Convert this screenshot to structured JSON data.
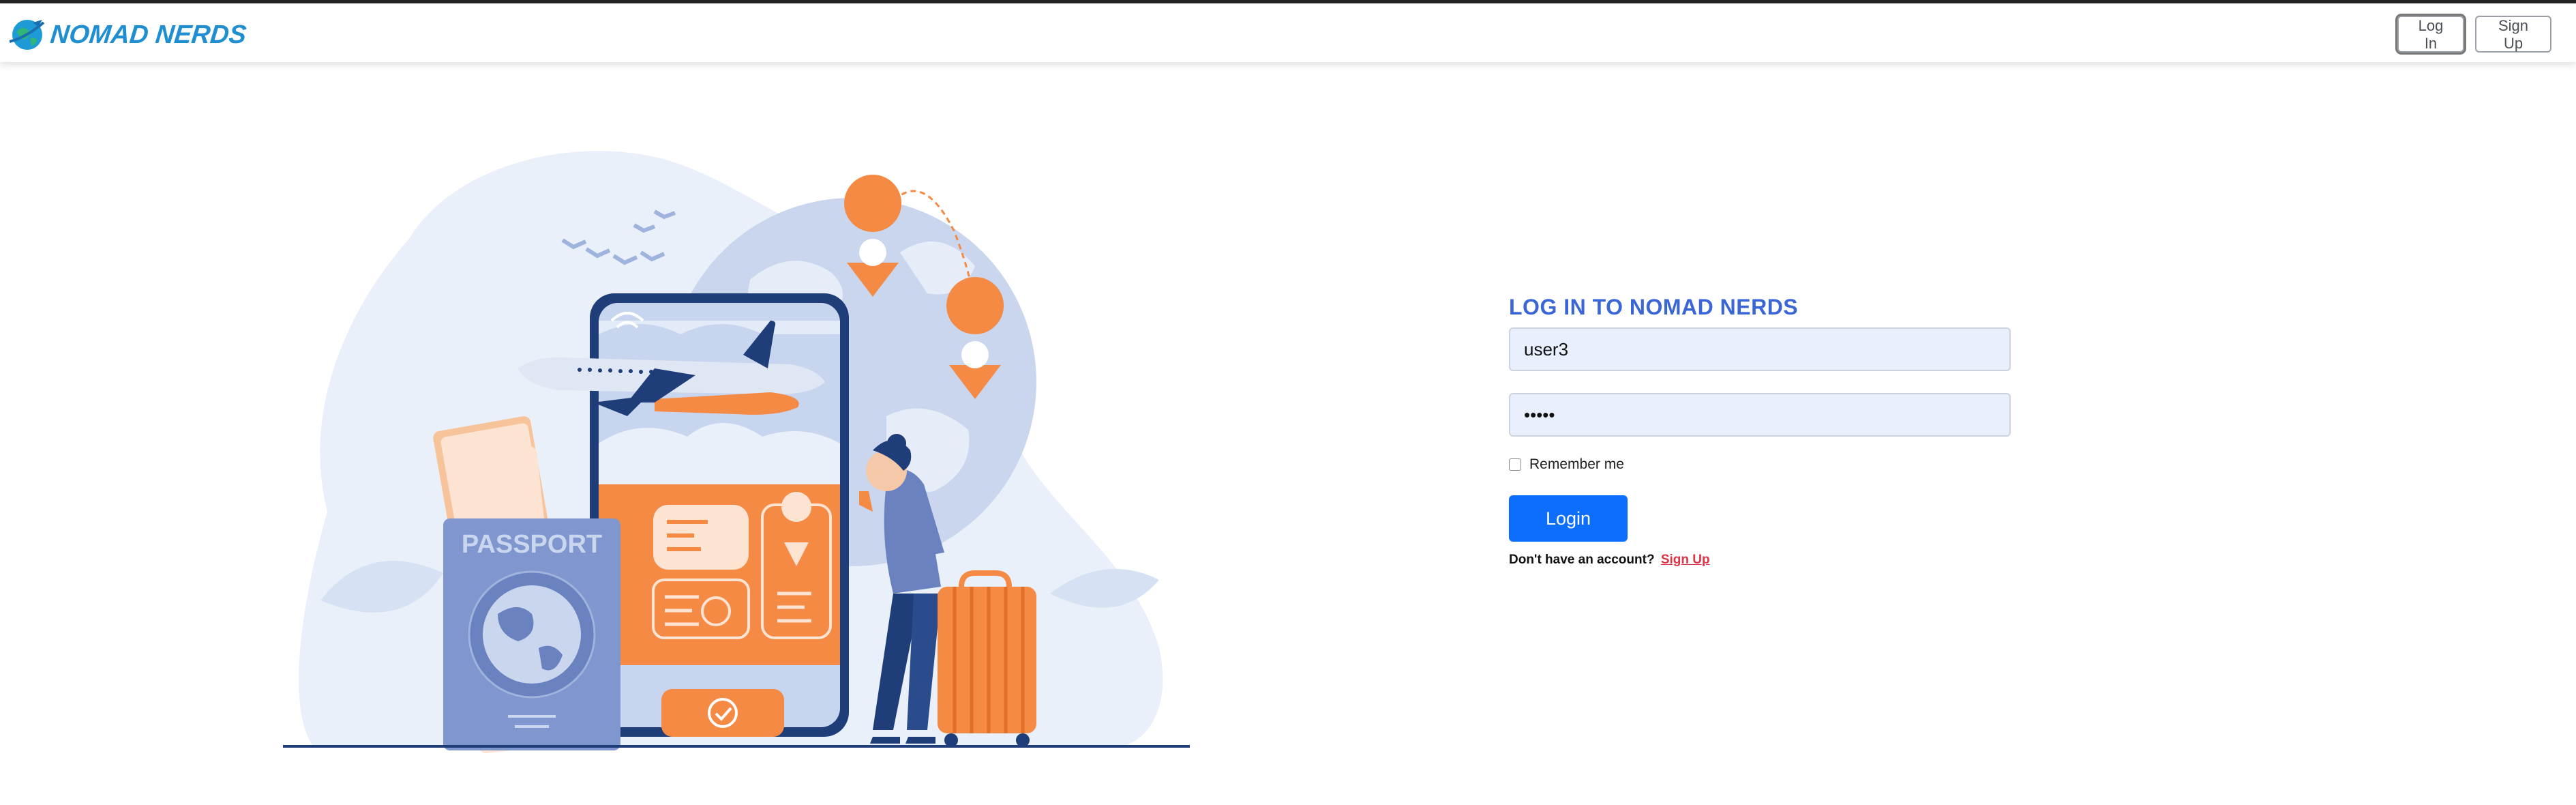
{
  "brand": {
    "name": "NOMAD NERDS"
  },
  "navbar": {
    "login_label": "Log In",
    "signup_label": "Sign Up"
  },
  "illustration": {
    "passport_text": "PASSPORT"
  },
  "login_form": {
    "title": "LOG IN TO NOMAD NERDS",
    "username_value": "user3",
    "password_value": "12345",
    "remember_label": "Remember me",
    "remember_checked": false,
    "submit_label": "Login",
    "signup_prompt": "Don't have an account?",
    "signup_link": "Sign Up"
  },
  "colors": {
    "title_blue": "#3a66d6",
    "primary_button": "#0d6efd",
    "link_red": "#dc3545",
    "brand_blue": "#1f8fd1",
    "accent_orange": "#f58a45",
    "input_fill": "#e8f0fe"
  }
}
